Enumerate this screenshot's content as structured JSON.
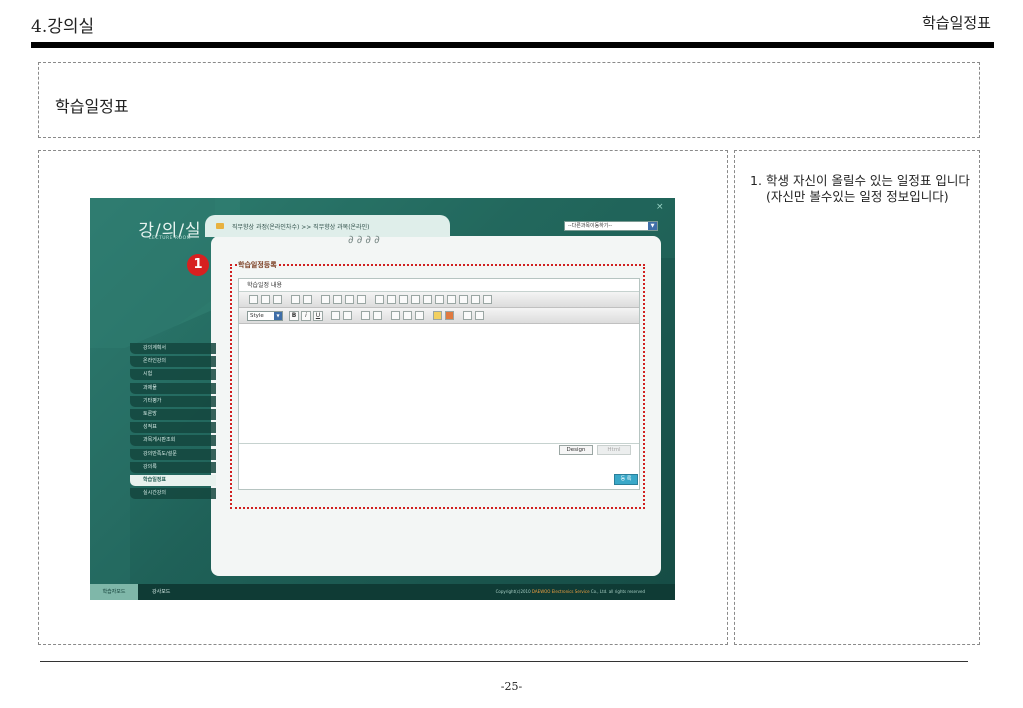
{
  "header": {
    "section": "4.강의실",
    "page_name": "학습일정표"
  },
  "title_box": {
    "title": "학습일정표"
  },
  "notes": [
    {
      "number": "1.",
      "text": "학생 자신이 올릴수 있는 일정표 입니다(자신만 볼수있는 일정 정보입니다)"
    }
  ],
  "footer": {
    "page_number": "-25-"
  },
  "screenshot": {
    "logo": "강/의/실",
    "logo_sub": "LECTURE ROOM",
    "breadcrumb": "직무향상 과정(온라인차수) >> 직무향상 과목(온라인)",
    "subject_select": "--다른과목이동하기--",
    "close_glyph": "×",
    "nav_items": [
      {
        "label": "강의계획서"
      },
      {
        "label": "온라인강의"
      },
      {
        "label": "시험"
      },
      {
        "label": "과제물"
      },
      {
        "label": "기타평가"
      },
      {
        "label": "토론방"
      },
      {
        "label": "성적표"
      },
      {
        "label": "과목게시판조회"
      },
      {
        "label": "강의만족도/설문"
      },
      {
        "label": "강의록"
      },
      {
        "label": "학습일정표",
        "active": true
      },
      {
        "label": "실시간강의"
      }
    ],
    "mode_student": "학습자모드",
    "mode_teacher": "강사모드",
    "copyright_prefix": "Copyright(c)2010 ",
    "copyright_brand": "DAEWOO Electronics Service",
    "copyright_suffix": " Co., Ltd. all rights reserved",
    "badge": "1",
    "form_title": "학습일정등록",
    "editor_label": "학습일정 내용",
    "style_select": "Style",
    "fmt_bold": "B",
    "fmt_italic": "i",
    "fmt_underline": "U",
    "tab_design": "Design",
    "tab_html": "Html",
    "save_label": "등 록"
  }
}
